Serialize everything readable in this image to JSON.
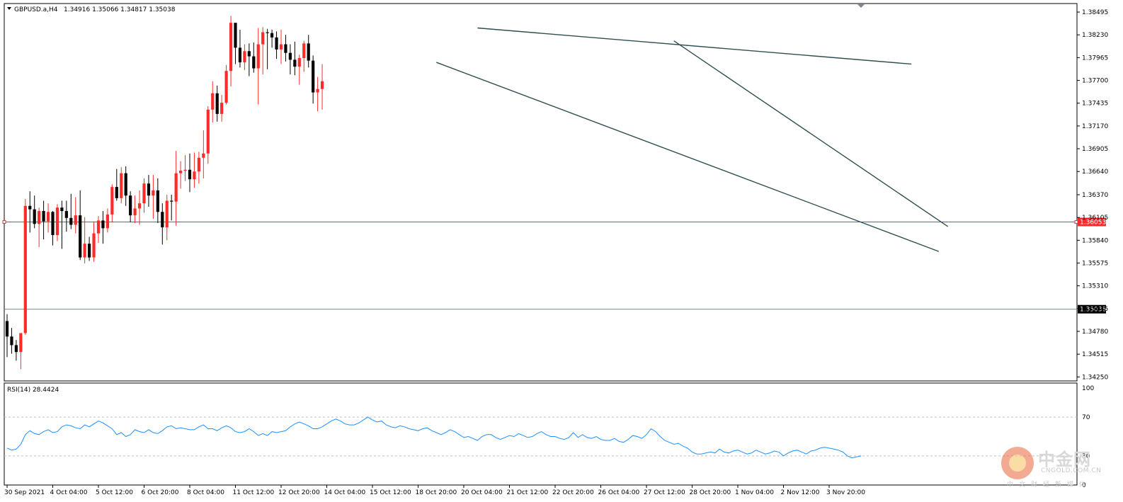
{
  "chart_data": [
    {
      "type": "candlestick",
      "symbol_header": "GBPUSD.a,H4",
      "ohlc_header": "1.34916 1.35066 1.34817 1.35038",
      "colors": {
        "bull": "#ff2b2b",
        "bear": "#000000",
        "background": "#ffffff",
        "axis": "#000000"
      },
      "y_ticks": [
        "1.38495",
        "1.38230",
        "1.37965",
        "1.37700",
        "1.37435",
        "1.37170",
        "1.36905",
        "1.36640",
        "1.36370",
        "1.36105",
        "1.35840",
        "1.35575",
        "1.35310",
        "1.35045",
        "1.34780",
        "1.34515",
        "1.34250"
      ],
      "ylim": [
        1.3422,
        1.3852
      ],
      "x_ticks": [
        {
          "i": 0,
          "label": "30 Sep 2021"
        },
        {
          "i": 10,
          "label": "4 Oct 04:00"
        },
        {
          "i": 20,
          "label": "5 Oct 12:00"
        },
        {
          "i": 30,
          "label": "6 Oct 20:00"
        },
        {
          "i": 40,
          "label": "8 Oct 04:00"
        },
        {
          "i": 50,
          "label": "11 Oct 12:00"
        },
        {
          "i": 60,
          "label": "12 Oct 20:00"
        },
        {
          "i": 70,
          "label": "14 Oct 04:00"
        },
        {
          "i": 80,
          "label": "15 Oct 12:00"
        },
        {
          "i": 90,
          "label": "18 Oct 20:00"
        },
        {
          "i": 100,
          "label": "20 Oct 04:00"
        },
        {
          "i": 110,
          "label": "21 Oct 12:00"
        },
        {
          "i": 120,
          "label": "22 Oct 20:00"
        },
        {
          "i": 130,
          "label": "26 Oct 04:00"
        },
        {
          "i": 140,
          "label": "27 Oct 12:00"
        },
        {
          "i": 150,
          "label": "28 Oct 20:00"
        },
        {
          "i": 160,
          "label": "1 Nov 04:00"
        },
        {
          "i": 170,
          "label": "2 Nov 12:00"
        },
        {
          "i": 180,
          "label": "3 Nov 20:00"
        }
      ],
      "horizontal_levels": [
        {
          "value": 1.36053,
          "label": "1.36053",
          "color": "#ff2b2b",
          "style": "solid"
        },
        {
          "value": 1.35038,
          "label": "1.35038",
          "color": "#7c8792",
          "style": "solid"
        }
      ],
      "trendlines": [
        {
          "from": {
            "i": 103,
            "y": 1.3831
          },
          "to": {
            "i": 198,
            "y": 1.3789
          }
        },
        {
          "from": {
            "i": 94,
            "y": 1.3791
          },
          "to": {
            "i": 204,
            "y": 1.3571
          }
        },
        {
          "from": {
            "i": 146,
            "y": 1.3816
          },
          "to": {
            "i": 206,
            "y": 1.36
          }
        }
      ],
      "candles": [
        [
          1.349,
          1.3498,
          1.3448,
          1.3472
        ],
        [
          1.3472,
          1.3482,
          1.3452,
          1.3462
        ],
        [
          1.3462,
          1.3468,
          1.3444,
          1.3454
        ],
        [
          1.3454,
          1.3458,
          1.3434,
          1.3476
        ],
        [
          1.3476,
          1.3632,
          1.3474,
          1.3624
        ],
        [
          1.3624,
          1.3641,
          1.3593,
          1.362
        ],
        [
          1.362,
          1.3636,
          1.3598,
          1.3603
        ],
        [
          1.3603,
          1.3622,
          1.3576,
          1.3618
        ],
        [
          1.3618,
          1.363,
          1.3585,
          1.3606
        ],
        [
          1.3606,
          1.3627,
          1.3593,
          1.3617
        ],
        [
          1.3617,
          1.3618,
          1.3578,
          1.359
        ],
        [
          1.359,
          1.3626,
          1.3583,
          1.3622
        ],
        [
          1.3622,
          1.363,
          1.3574,
          1.3618
        ],
        [
          1.3618,
          1.363,
          1.3594,
          1.361
        ],
        [
          1.361,
          1.3638,
          1.3597,
          1.3602
        ],
        [
          1.3602,
          1.3634,
          1.3592,
          1.3613
        ],
        [
          1.3613,
          1.3642,
          1.3561,
          1.3564
        ],
        [
          1.3564,
          1.3611,
          1.3557,
          1.358
        ],
        [
          1.358,
          1.3588,
          1.356,
          1.3564
        ],
        [
          1.3564,
          1.3606,
          1.3559,
          1.3592
        ],
        [
          1.3592,
          1.3612,
          1.3581,
          1.3607
        ],
        [
          1.3607,
          1.3618,
          1.358,
          1.3598
        ],
        [
          1.3598,
          1.3621,
          1.3593,
          1.3614
        ],
        [
          1.3614,
          1.3649,
          1.3605,
          1.3646
        ],
        [
          1.3646,
          1.3667,
          1.363,
          1.3633
        ],
        [
          1.3633,
          1.3669,
          1.3627,
          1.3662
        ],
        [
          1.3662,
          1.367,
          1.3624,
          1.3636
        ],
        [
          1.3636,
          1.3641,
          1.3605,
          1.3613
        ],
        [
          1.3613,
          1.3636,
          1.3604,
          1.3621
        ],
        [
          1.3621,
          1.3642,
          1.3602,
          1.3627
        ],
        [
          1.3627,
          1.3656,
          1.3616,
          1.365
        ],
        [
          1.365,
          1.366,
          1.3623,
          1.3636
        ],
        [
          1.3636,
          1.366,
          1.3609,
          1.3642
        ],
        [
          1.3642,
          1.3656,
          1.3604,
          1.3617
        ],
        [
          1.3617,
          1.3627,
          1.3579,
          1.3599
        ],
        [
          1.3599,
          1.3637,
          1.3584,
          1.363
        ],
        [
          1.363,
          1.3637,
          1.3607,
          1.3629
        ],
        [
          1.3629,
          1.3688,
          1.3601,
          1.3662
        ],
        [
          1.3662,
          1.3676,
          1.3644,
          1.3665
        ],
        [
          1.3665,
          1.3683,
          1.3653,
          1.3666
        ],
        [
          1.3666,
          1.3685,
          1.364,
          1.3655
        ],
        [
          1.3655,
          1.3686,
          1.3645,
          1.3664
        ],
        [
          1.3664,
          1.3687,
          1.365,
          1.368
        ],
        [
          1.368,
          1.3712,
          1.3656,
          1.3685
        ],
        [
          1.3685,
          1.374,
          1.3673,
          1.3736
        ],
        [
          1.3736,
          1.3769,
          1.3721,
          1.3755
        ],
        [
          1.3755,
          1.3764,
          1.3722,
          1.3731
        ],
        [
          1.3731,
          1.3753,
          1.3722,
          1.3744
        ],
        [
          1.3744,
          1.3788,
          1.3742,
          1.3781
        ],
        [
          1.3781,
          1.3845,
          1.3763,
          1.3837
        ],
        [
          1.3837,
          1.3826,
          1.3789,
          1.3808
        ],
        [
          1.3808,
          1.3829,
          1.3785,
          1.3791
        ],
        [
          1.3791,
          1.3812,
          1.3782,
          1.3804
        ],
        [
          1.3804,
          1.3813,
          1.3775,
          1.3798
        ],
        [
          1.3798,
          1.3814,
          1.3779,
          1.3784
        ],
        [
          1.3784,
          1.3831,
          1.3742,
          1.3812
        ],
        [
          1.3812,
          1.3832,
          1.3777,
          1.3826
        ],
        [
          1.3826,
          1.383,
          1.3783,
          1.3825
        ],
        [
          1.3825,
          1.3829,
          1.3808,
          1.382
        ],
        [
          1.382,
          1.3827,
          1.3795,
          1.3806
        ],
        [
          1.3806,
          1.3829,
          1.3789,
          1.3812
        ],
        [
          1.3812,
          1.3823,
          1.3792,
          1.3802
        ],
        [
          1.3802,
          1.3812,
          1.3777,
          1.3794
        ],
        [
          1.3794,
          1.3815,
          1.3776,
          1.3786
        ],
        [
          1.3786,
          1.38,
          1.3765,
          1.3796
        ],
        [
          1.3796,
          1.3816,
          1.378,
          1.3813
        ],
        [
          1.3813,
          1.3823,
          1.3785,
          1.3793
        ],
        [
          1.3793,
          1.3799,
          1.3743,
          1.3756
        ],
        [
          1.3756,
          1.3774,
          1.3734,
          1.376
        ],
        [
          1.376,
          1.3789,
          1.3736,
          1.3769
        ]
      ],
      "rsi": {
        "label": "RSI(14) 28.4424",
        "ylim": [
          0,
          100
        ],
        "levels": [
          70,
          30
        ],
        "right_labels": [
          "100",
          "70",
          "30",
          "0"
        ],
        "color": "#1e90ff",
        "values": [
          38,
          36,
          37,
          42,
          52,
          56,
          53,
          52,
          55,
          57,
          54,
          55,
          60,
          62,
          61,
          59,
          58,
          62,
          60,
          63,
          66,
          64,
          61,
          58,
          52,
          54,
          50,
          52,
          57,
          55,
          54,
          57,
          54,
          53,
          56,
          60,
          61,
          58,
          59,
          58,
          57,
          57,
          60,
          62,
          58,
          58,
          56,
          59,
          61,
          59,
          55,
          54,
          55,
          58,
          55,
          51,
          53,
          51,
          55,
          54,
          55,
          56,
          60,
          63,
          65,
          63,
          61,
          58,
          58,
          60,
          63,
          66,
          68,
          66,
          63,
          62,
          62,
          64,
          67,
          70,
          67,
          65,
          66,
          62,
          60,
          59,
          61,
          60,
          58,
          57,
          56,
          58,
          59,
          56,
          54,
          52,
          54,
          57,
          55,
          52,
          49,
          50,
          48,
          46,
          50,
          52,
          52,
          49,
          47,
          49,
          51,
          50,
          53,
          51,
          49,
          50,
          53,
          55,
          52,
          50,
          50,
          48,
          47,
          49,
          54,
          49,
          52,
          49,
          48,
          50,
          47,
          46,
          46,
          48,
          45,
          44,
          47,
          51,
          50,
          48,
          52,
          58,
          55,
          50,
          46,
          44,
          42,
          43,
          40,
          38,
          34,
          32,
          32,
          33,
          34,
          33,
          37,
          34,
          33,
          35,
          36,
          34,
          32,
          33,
          36,
          34,
          32,
          33,
          35,
          34,
          30,
          33,
          35,
          36,
          34,
          32,
          35,
          36,
          38,
          39,
          38,
          37,
          36,
          34,
          30,
          28,
          29,
          30
        ]
      }
    }
  ],
  "watermark": {
    "title": "中金网",
    "domain": "CNGOLD.COM.CN",
    "subtitle": "中文财经新媒体"
  }
}
